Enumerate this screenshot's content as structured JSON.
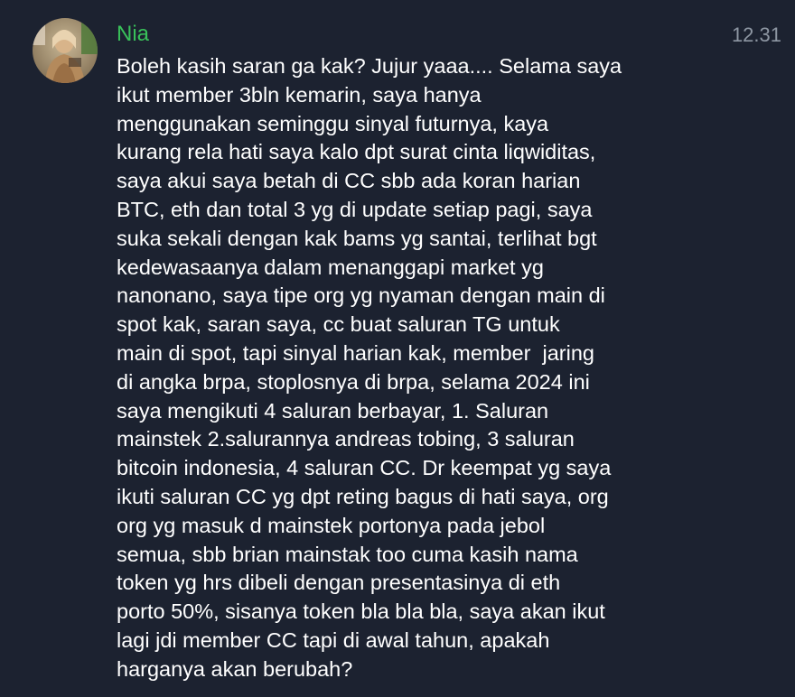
{
  "message": {
    "sender": "Nia",
    "time": "12.31",
    "avatar": "avatar-photo",
    "lines": [
      "Boleh kasih saran ga kak? Jujur yaaa.... Selama saya",
      "ikut member 3bln kemarin, saya hanya",
      "menggunakan seminggu sinyal futurnya, kaya",
      "kurang rela hati saya kalo dpt surat cinta liqwiditas,",
      "saya akui saya betah di CC sbb ada koran harian",
      "BTC, eth dan total 3 yg di update setiap pagi, saya",
      "suka sekali dengan kak bams yg santai, terlihat bgt",
      "kedewasaanya dalam menanggapi market yg",
      "nanonano, saya tipe org yg nyaman dengan main di",
      "spot kak, saran saya, cc buat saluran TG untuk",
      "main di spot, tapi sinyal harian kak, member  jaring",
      "di angka brpa, stoplosnya di brpa, selama 2024 ini",
      "saya mengikuti 4 saluran berbayar, 1. Saluran",
      "mainstek 2.salurannya andreas tobing, 3 saluran",
      "bitcoin indonesia, 4 saluran CC. Dr keempat yg saya",
      "ikuti saluran CC yg dpt reting bagus di hati saya, org",
      "org yg masuk d mainstek portonya pada jebol",
      "semua, sbb brian mainstak too cuma kasih nama",
      "token yg hrs dibeli dengan presentasinya di eth",
      "porto 50%, sisanya token bla bla bla, saya akan ikut",
      "lagi jdi member CC tapi di awal tahun, apakah",
      "harganya akan berubah?"
    ]
  },
  "colors": {
    "background": "#1c2230",
    "sender": "#39c15a",
    "text": "#ffffff",
    "time": "#8e97a3"
  }
}
